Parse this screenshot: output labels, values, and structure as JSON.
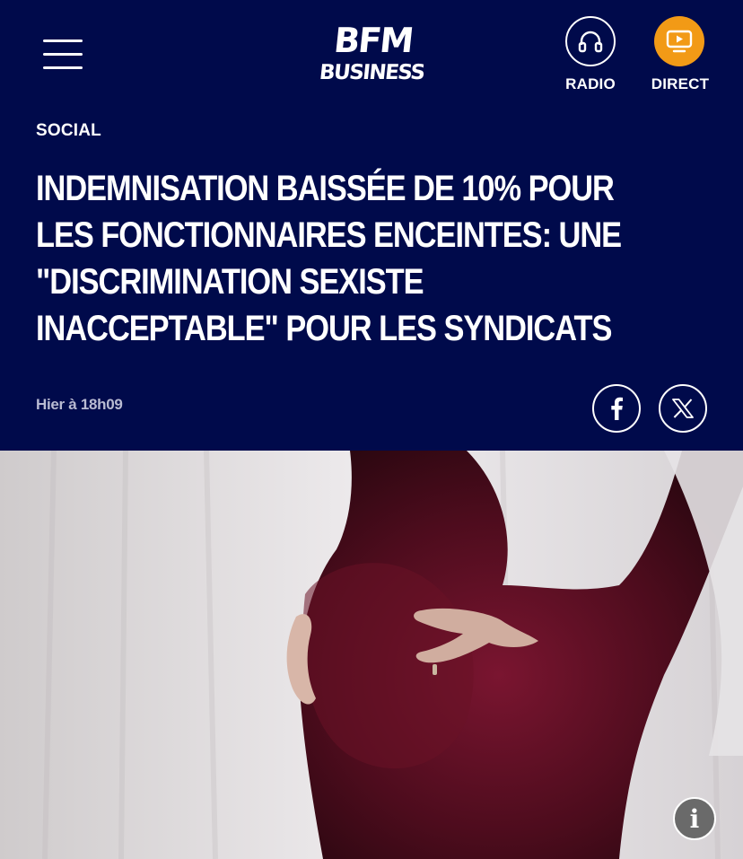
{
  "header": {
    "logo_line1": "BFM",
    "logo_line2": "BUSINESS",
    "radio_label": "RADIO",
    "direct_label": "DIRECT",
    "accent_color": "#f29a16",
    "background_color": "#000a4b"
  },
  "article": {
    "category": "SOCIAL",
    "title": "INDEMNISATION BAISSÉE DE 10% POUR LES FONCTIONNAIRES ENCEINTES: UNE \"DISCRIMINATION SEXISTE INACCEPTABLE\" POUR LES SYNDICATS",
    "timestamp": "Hier à 18h09"
  },
  "share": {
    "facebook_icon": "facebook-icon",
    "x_icon": "x-icon"
  },
  "image": {
    "info_label": "i"
  }
}
